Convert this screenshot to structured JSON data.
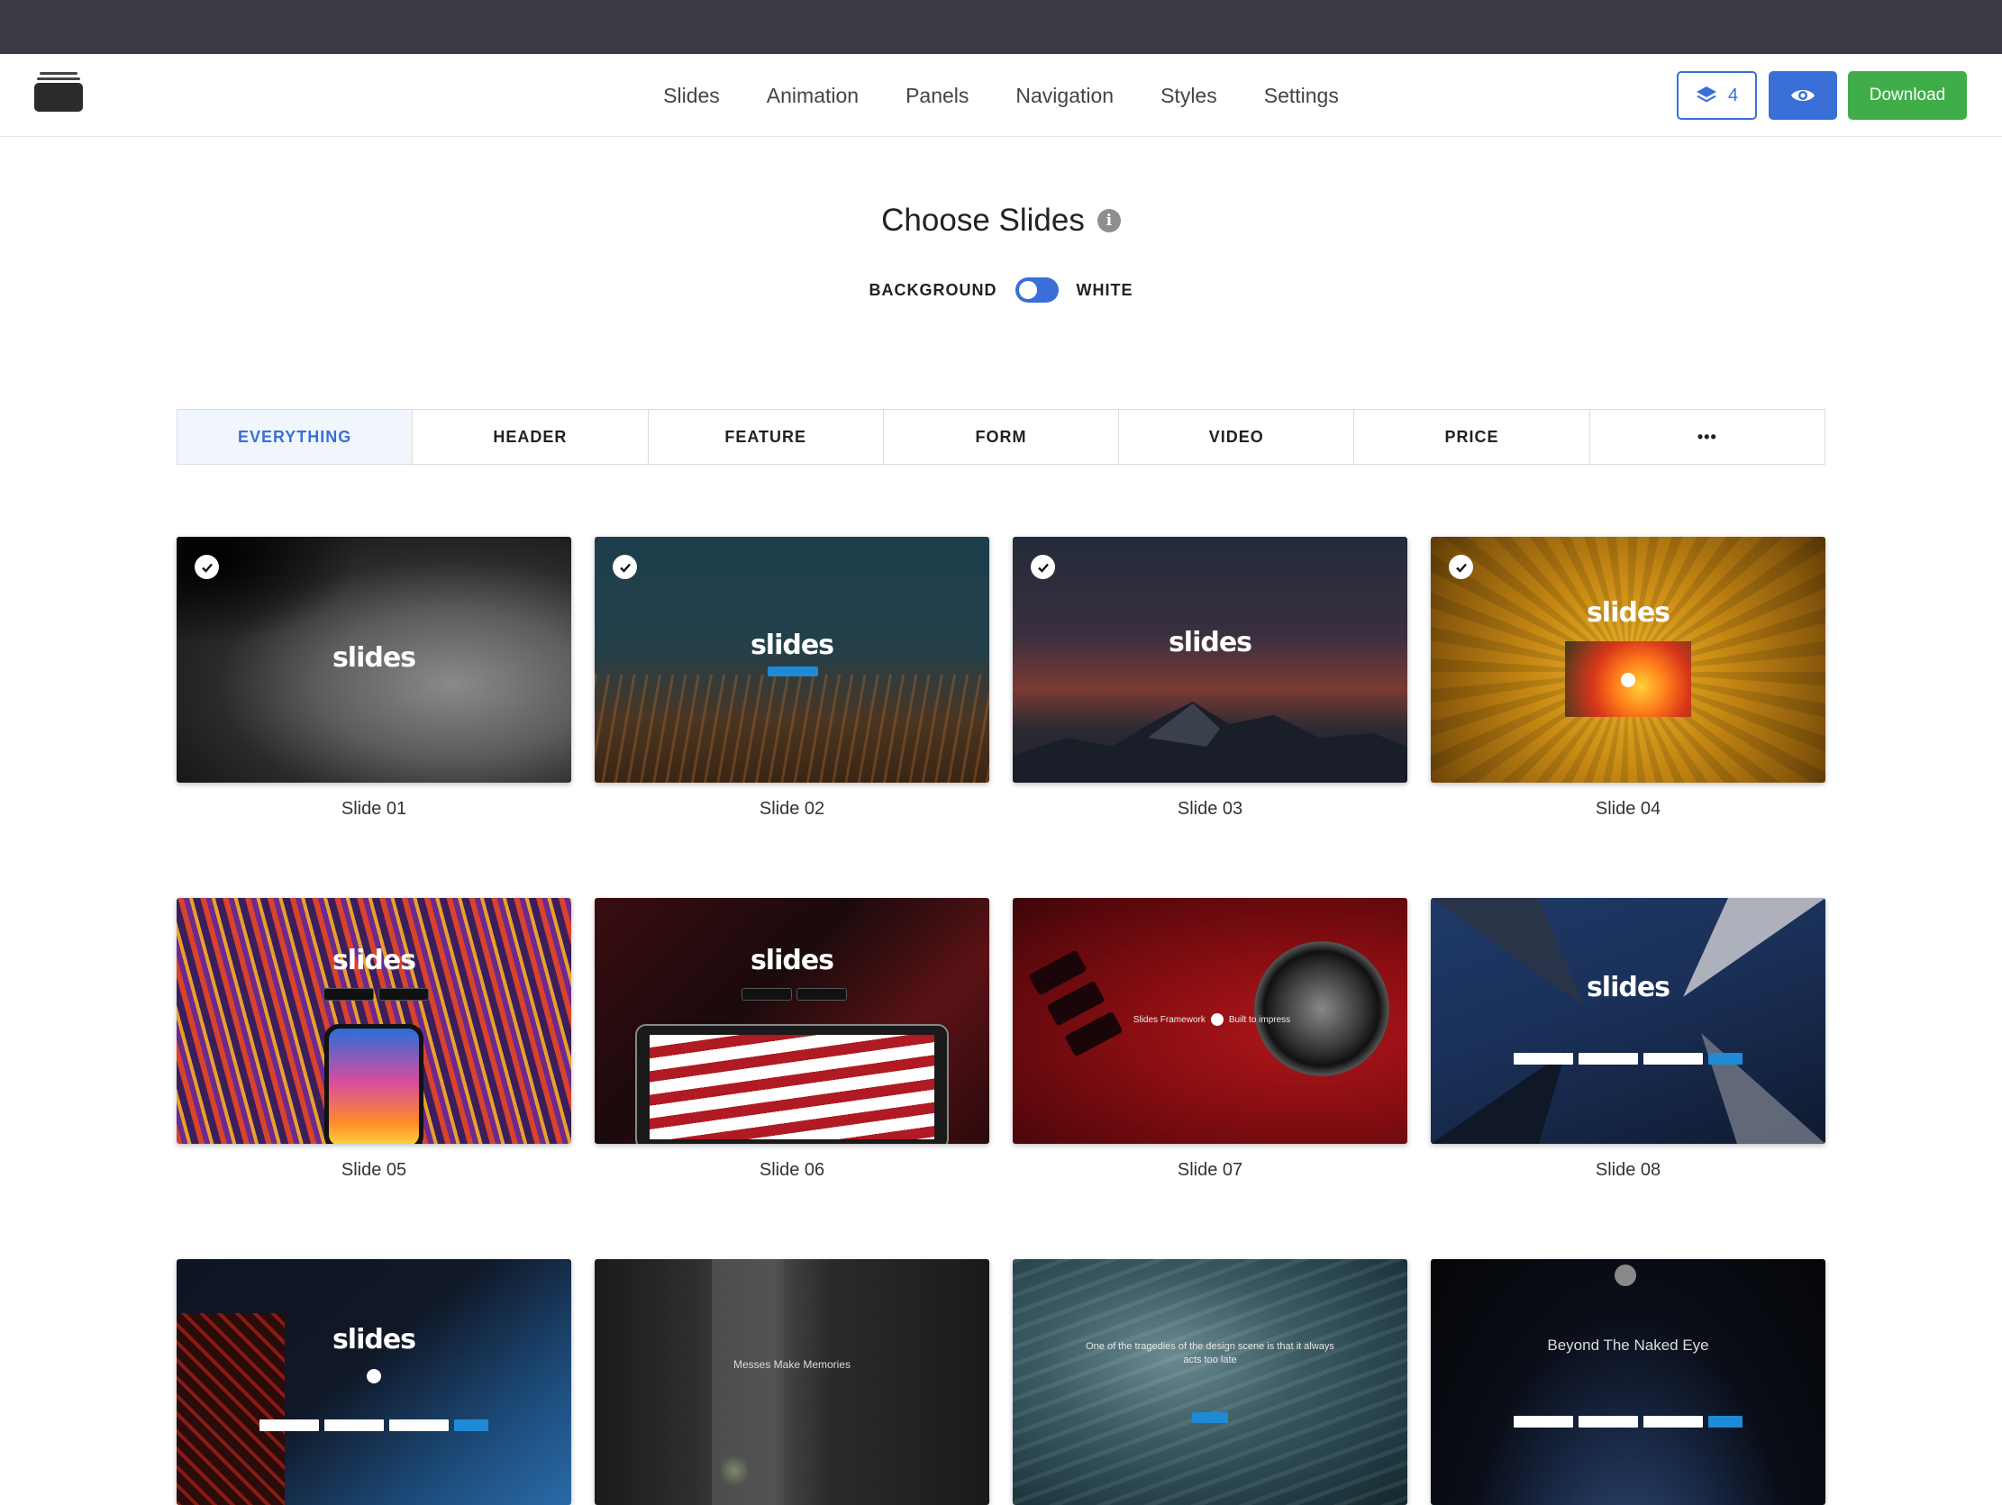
{
  "nav": {
    "menu": [
      "Slides",
      "Animation",
      "Panels",
      "Navigation",
      "Styles",
      "Settings"
    ],
    "layers_count": "4",
    "download_label": "Download",
    "accent": "#3a6fd8",
    "download_color": "#3fae49"
  },
  "page": {
    "title": "Choose Slides",
    "info_icon": "i",
    "toggle_left": "BACKGROUND",
    "toggle_right": "WHITE"
  },
  "filters": [
    "EVERYTHING",
    "HEADER",
    "FEATURE",
    "FORM",
    "VIDEO",
    "PRICE",
    "•••"
  ],
  "slides": [
    {
      "caption": "Slide 01",
      "selected": true,
      "brand": "slides"
    },
    {
      "caption": "Slide 02",
      "selected": true,
      "brand": "slides"
    },
    {
      "caption": "Slide 03",
      "selected": true,
      "brand": "slides"
    },
    {
      "caption": "Slide 04",
      "selected": true,
      "brand": "slides"
    },
    {
      "caption": "Slide 05",
      "selected": false,
      "brand": "slides"
    },
    {
      "caption": "Slide 06",
      "selected": false,
      "brand": "slides"
    },
    {
      "caption": "Slide 07",
      "selected": false,
      "text_left": "Slides Framework",
      "text_right": "Built to impress"
    },
    {
      "caption": "Slide 08",
      "selected": false,
      "brand": "slides"
    },
    {
      "caption": "",
      "selected": false,
      "brand": "slides"
    },
    {
      "caption": "",
      "selected": false,
      "headline": "Messes Make Memories"
    },
    {
      "caption": "",
      "selected": false,
      "headline": "One of the tragedies of the design scene is that it always acts too late"
    },
    {
      "caption": "",
      "selected": false,
      "headline": "Beyond The Naked Eye"
    }
  ]
}
